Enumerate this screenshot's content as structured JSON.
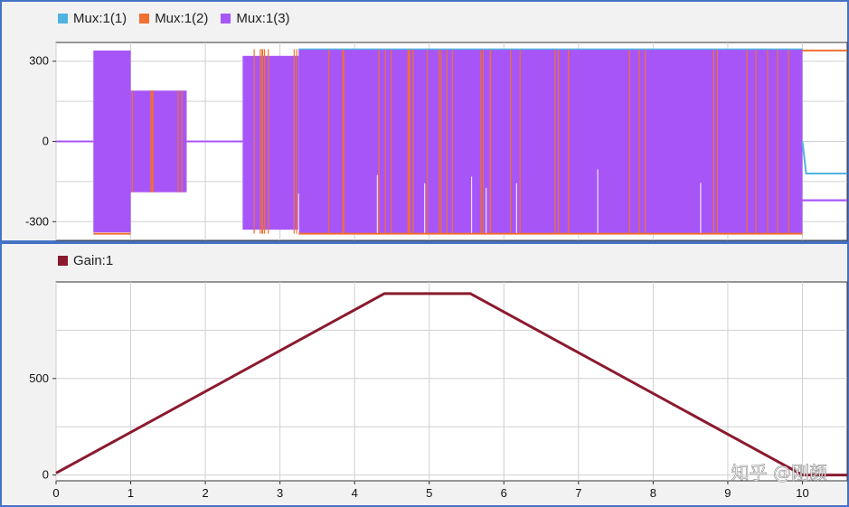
{
  "chart_data": [
    {
      "type": "line",
      "title": "",
      "xlabel": "",
      "ylabel": "",
      "xlim": [
        0,
        10.6
      ],
      "ylim": [
        -370,
        370
      ],
      "y_ticks": [
        300,
        0,
        -300
      ],
      "y_tick_labels": [
        "300",
        "0",
        "-300"
      ],
      "grid": true,
      "legend_position": "top-left",
      "series": [
        {
          "name": "Mux:1(1)",
          "color": "#4fb3e0",
          "x": [
            0,
            0.5,
            0.5,
            10.0,
            10.0,
            10.6
          ],
          "y": [
            0,
            0,
            340,
            340,
            -120,
            -120
          ]
        },
        {
          "name": "Mux:1(2)",
          "color": "#f07030",
          "x": [
            0,
            0.5,
            0.5,
            10.0,
            10.0,
            10.6
          ],
          "y": [
            0,
            0,
            -345,
            -345,
            340,
            340
          ]
        },
        {
          "name": "Mux:1(3)",
          "color": "#a855f7",
          "envelope": [
            {
              "x0": 0,
              "x1": 0.5,
              "top": 0,
              "bottom": 0
            },
            {
              "x0": 0.5,
              "x1": 1.0,
              "top": 340,
              "bottom": -340
            },
            {
              "x0": 1.0,
              "x1": 1.75,
              "top": 190,
              "bottom": -190
            },
            {
              "x0": 1.75,
              "x1": 2.5,
              "top": 0,
              "bottom": 0
            },
            {
              "x0": 2.5,
              "x1": 3.25,
              "top": 320,
              "bottom": -330
            },
            {
              "x0": 3.25,
              "x1": 10.0,
              "top": 345,
              "bottom": -345
            },
            {
              "x0": 10.0,
              "x1": 10.6,
              "top": -220,
              "bottom": -220
            }
          ]
        }
      ]
    },
    {
      "type": "line",
      "title": "",
      "xlabel": "",
      "ylabel": "",
      "xlim": [
        0,
        10.6
      ],
      "ylim": [
        -30,
        1000
      ],
      "y_ticks": [
        500,
        0
      ],
      "y_tick_labels": [
        "500",
        "0"
      ],
      "x_ticks": [
        0,
        1,
        2,
        3,
        4,
        5,
        6,
        7,
        8,
        9,
        10
      ],
      "x_tick_labels": [
        "0",
        "1",
        "2",
        "3",
        "4",
        "5",
        "6",
        "7",
        "8",
        "9",
        "10"
      ],
      "grid": true,
      "legend_position": "top-left",
      "series": [
        {
          "name": "Gain:1",
          "color": "#8b1a2e",
          "x": [
            0,
            4.4,
            5.55,
            10.0,
            10.6
          ],
          "y": [
            10,
            940,
            940,
            0,
            0
          ]
        }
      ]
    }
  ],
  "watermark": "知乎 @刚颜"
}
